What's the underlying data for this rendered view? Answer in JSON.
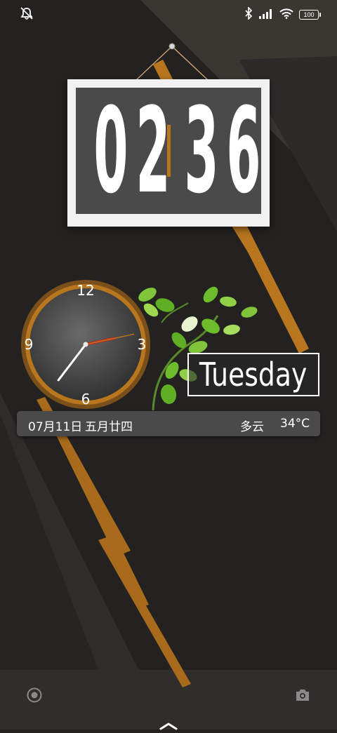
{
  "status_bar": {
    "left_icon": "bell-off-icon",
    "right_icons": [
      "bluetooth-icon",
      "signal-icon",
      "wifi-icon",
      "battery-icon"
    ],
    "battery_level": "100"
  },
  "digital_clock": {
    "h1": "0",
    "h2": "2",
    "m1": "3",
    "m2": "6"
  },
  "analog_clock": {
    "numbers": [
      "12",
      "3",
      "6",
      "9"
    ],
    "hour": 2,
    "minute": 36,
    "second": 13
  },
  "day_of_week": "Tuesday",
  "info_bar": {
    "date": "07月11日",
    "lunar": "五月廿四",
    "weather": "多云",
    "temperature": "34°C"
  },
  "bottom": {
    "left_icon": "record-icon",
    "right_icon": "camera-icon",
    "center_icon": "chevron-up-icon"
  },
  "colors": {
    "accent": "#b8761f",
    "background": "#232221",
    "card": "#4a4a4a"
  }
}
